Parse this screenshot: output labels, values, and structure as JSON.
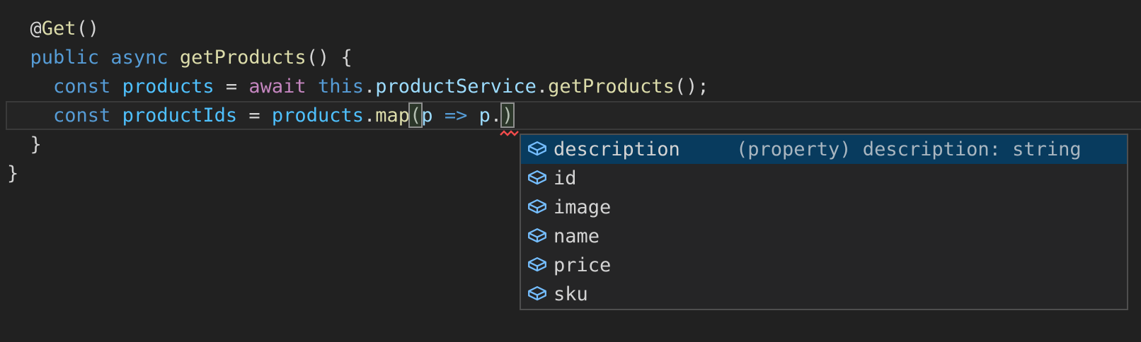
{
  "palette": {
    "editor_bg": "#212121",
    "linehl_bg": "#242424",
    "linehl_border": "#3a3a3a",
    "bracket_border": "#8f8f8f",
    "bracket_bg": "rgba(70,120,60,0.22)",
    "error_squiggle": "#f14c4c",
    "suggest_bg": "#252526",
    "suggest_border": "#4e4e4e",
    "suggest_selected_bg": "#083b5e",
    "suggest_label": "#d4d4d4",
    "suggest_detail": "#a9b6c0",
    "icon_field": "#75beff",
    "tok_punct": "#d4d4d4",
    "tok_keyword": "#569cd6",
    "tok_func": "#dcdcaa",
    "tok_constvar": "#4fc1ff",
    "tok_prop": "#9cdcfe",
    "tok_control": "#c586c0"
  },
  "editor": {
    "current_line_index": 3,
    "lines": [
      {
        "tokens": [
          {
            "text": "  @",
            "color": "punct"
          },
          {
            "text": "Get",
            "color": "func"
          },
          {
            "text": "()",
            "color": "punct"
          }
        ]
      },
      {
        "tokens": [
          {
            "text": "  ",
            "color": "punct"
          },
          {
            "text": "public",
            "color": "keyword"
          },
          {
            "text": " ",
            "color": "punct"
          },
          {
            "text": "async",
            "color": "keyword"
          },
          {
            "text": " ",
            "color": "punct"
          },
          {
            "text": "getProducts",
            "color": "func"
          },
          {
            "text": "() {",
            "color": "punct"
          }
        ]
      },
      {
        "tokens": [
          {
            "text": "    ",
            "color": "punct"
          },
          {
            "text": "const",
            "color": "keyword"
          },
          {
            "text": " ",
            "color": "punct"
          },
          {
            "text": "products",
            "color": "constvar"
          },
          {
            "text": " = ",
            "color": "punct"
          },
          {
            "text": "await",
            "color": "control"
          },
          {
            "text": " ",
            "color": "punct"
          },
          {
            "text": "this",
            "color": "keyword"
          },
          {
            "text": ".",
            "color": "punct"
          },
          {
            "text": "productService",
            "color": "prop"
          },
          {
            "text": ".",
            "color": "punct"
          },
          {
            "text": "getProducts",
            "color": "func"
          },
          {
            "text": "();",
            "color": "punct"
          }
        ]
      },
      {
        "tokens": [
          {
            "text": "    ",
            "color": "punct"
          },
          {
            "text": "const",
            "color": "keyword"
          },
          {
            "text": " ",
            "color": "punct"
          },
          {
            "text": "productIds",
            "color": "constvar"
          },
          {
            "text": " = ",
            "color": "punct"
          },
          {
            "text": "products",
            "color": "constvar"
          },
          {
            "text": ".",
            "color": "punct"
          },
          {
            "text": "map",
            "color": "func"
          },
          {
            "text": "(",
            "color": "punct",
            "bracket_match": true
          },
          {
            "text": "p",
            "color": "prop"
          },
          {
            "text": " ",
            "color": "punct"
          },
          {
            "text": "=>",
            "color": "keyword"
          },
          {
            "text": " ",
            "color": "punct"
          },
          {
            "text": "p",
            "color": "prop"
          },
          {
            "text": ".",
            "color": "punct"
          },
          {
            "text": ")",
            "color": "punct",
            "bracket_match": true
          }
        ]
      },
      {
        "tokens": [
          {
            "text": "  }",
            "color": "punct"
          }
        ]
      },
      {
        "tokens": [
          {
            "text": "}",
            "color": "punct"
          }
        ]
      }
    ]
  },
  "suggest": {
    "items": [
      {
        "label": "description",
        "detail": "(property) description: string",
        "icon": "field-icon",
        "selected": true
      },
      {
        "label": "id",
        "detail": "",
        "icon": "field-icon",
        "selected": false
      },
      {
        "label": "image",
        "detail": "",
        "icon": "field-icon",
        "selected": false
      },
      {
        "label": "name",
        "detail": "",
        "icon": "field-icon",
        "selected": false
      },
      {
        "label": "price",
        "detail": "",
        "icon": "field-icon",
        "selected": false
      },
      {
        "label": "sku",
        "detail": "",
        "icon": "field-icon",
        "selected": false
      }
    ]
  }
}
